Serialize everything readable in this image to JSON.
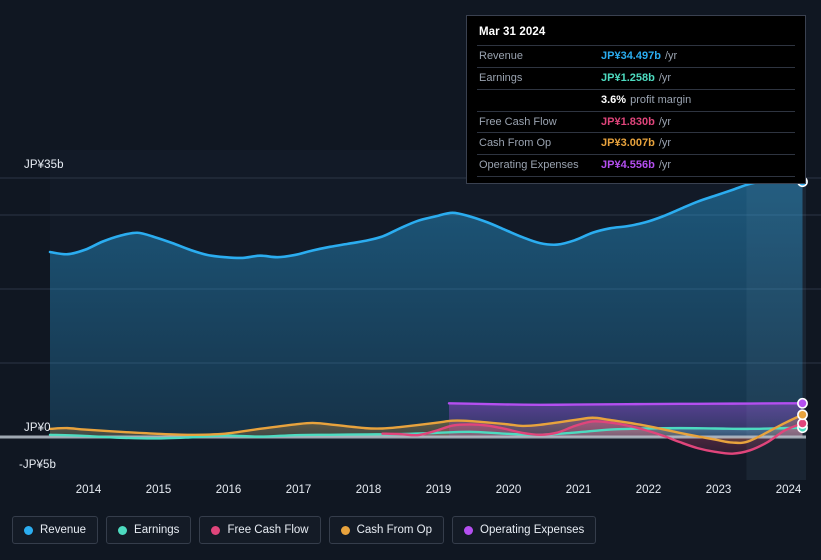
{
  "tooltip": {
    "date": "Mar 31 2024",
    "rows": [
      {
        "label": "Revenue",
        "value": "JP¥34.497b",
        "suffix": "/yr",
        "color": "#2badf0"
      },
      {
        "label": "Earnings",
        "value": "JP¥1.258b",
        "suffix": "/yr",
        "color": "#4ddbc0"
      },
      {
        "label": "",
        "value": "3.6%",
        "suffix": "profit margin",
        "color": "#ffffff"
      },
      {
        "label": "Free Cash Flow",
        "value": "JP¥1.830b",
        "suffix": "/yr",
        "color": "#e0457b"
      },
      {
        "label": "Cash From Op",
        "value": "JP¥3.007b",
        "suffix": "/yr",
        "color": "#e8a33d"
      },
      {
        "label": "Operating Expenses",
        "value": "JP¥4.556b",
        "suffix": "/yr",
        "color": "#b44ff0"
      }
    ]
  },
  "axis": {
    "y_top_label": "JP¥35b",
    "y_zero_label": "JP¥0",
    "y_bottom_label": "-JP¥5b"
  },
  "legend": {
    "items": [
      {
        "label": "Revenue",
        "color": "#2badf0"
      },
      {
        "label": "Earnings",
        "color": "#4ddbc0"
      },
      {
        "label": "Free Cash Flow",
        "color": "#e0457b"
      },
      {
        "label": "Cash From Op",
        "color": "#e8a33d"
      },
      {
        "label": "Operating Expenses",
        "color": "#b44ff0"
      }
    ]
  },
  "chart_data": {
    "type": "area",
    "title": "",
    "xlabel": "",
    "ylabel": "",
    "currency": "JP¥",
    "unit": "b",
    "grid": true,
    "legend_position": "bottom",
    "ylim": [
      -5,
      35
    ],
    "y_ticks": [
      -5,
      0,
      35
    ],
    "y_gridlines": [
      35,
      30,
      20,
      10,
      0
    ],
    "x_tick_labels": [
      "2014",
      "2015",
      "2016",
      "2017",
      "2018",
      "2019",
      "2020",
      "2021",
      "2022",
      "2023",
      "2024"
    ],
    "x_range": [
      2013.5,
      2024.3
    ],
    "series": [
      {
        "name": "Revenue",
        "color": "#2badf0",
        "filled": true,
        "x": [
          2013.5,
          2013.75,
          2014.0,
          2014.25,
          2014.5,
          2014.75,
          2015.0,
          2015.25,
          2015.5,
          2015.75,
          2016.0,
          2016.25,
          2016.5,
          2016.75,
          2017.0,
          2017.25,
          2017.5,
          2017.75,
          2018.0,
          2018.25,
          2018.5,
          2018.75,
          2019.0,
          2019.25,
          2019.5,
          2019.75,
          2020.0,
          2020.25,
          2020.5,
          2020.75,
          2021.0,
          2021.25,
          2021.5,
          2021.75,
          2022.0,
          2022.25,
          2022.5,
          2022.75,
          2023.0,
          2023.25,
          2023.5,
          2023.75,
          2024.0,
          2024.25
        ],
        "values": [
          25.0,
          24.7,
          25.3,
          26.4,
          27.2,
          27.6,
          27.0,
          26.2,
          25.3,
          24.6,
          24.3,
          24.2,
          24.5,
          24.3,
          24.6,
          25.2,
          25.7,
          26.1,
          26.5,
          27.1,
          28.2,
          29.2,
          29.8,
          30.3,
          29.8,
          29.0,
          28.0,
          27.0,
          26.2,
          26.0,
          26.6,
          27.6,
          28.2,
          28.5,
          29.0,
          29.8,
          30.8,
          31.8,
          32.6,
          33.4,
          34.2,
          34.6,
          34.7,
          34.497
        ]
      },
      {
        "name": "Earnings",
        "color": "#4ddbc0",
        "filled": true,
        "x": [
          2013.5,
          2014.0,
          2014.5,
          2015.0,
          2015.5,
          2016.0,
          2016.5,
          2017.0,
          2017.5,
          2018.0,
          2018.5,
          2019.0,
          2019.5,
          2020.0,
          2020.5,
          2021.0,
          2021.5,
          2022.0,
          2022.5,
          2023.0,
          2023.5,
          2024.0,
          2024.25
        ],
        "values": [
          0.3,
          0.15,
          -0.1,
          -0.2,
          -0.05,
          0.2,
          0.05,
          0.25,
          0.3,
          0.35,
          0.4,
          0.55,
          0.7,
          0.45,
          0.3,
          0.6,
          1.0,
          1.15,
          1.2,
          1.15,
          1.1,
          1.2,
          1.258
        ]
      },
      {
        "name": "Free Cash Flow",
        "color": "#e0457b",
        "filled": true,
        "x": [
          2018.25,
          2018.5,
          2018.75,
          2019.0,
          2019.25,
          2019.5,
          2019.75,
          2020.0,
          2020.25,
          2020.5,
          2020.75,
          2021.0,
          2021.25,
          2021.5,
          2021.75,
          2022.0,
          2022.25,
          2022.5,
          2022.75,
          2023.0,
          2023.25,
          2023.5,
          2023.75,
          2024.0,
          2024.25
        ],
        "values": [
          0.45,
          0.4,
          0.25,
          0.8,
          1.55,
          1.7,
          1.55,
          1.1,
          0.55,
          0.3,
          0.6,
          1.5,
          2.1,
          1.95,
          1.55,
          0.95,
          0.2,
          -0.7,
          -1.5,
          -2.0,
          -2.25,
          -1.8,
          -0.7,
          0.9,
          1.83
        ]
      },
      {
        "name": "Cash From Op",
        "color": "#e8a33d",
        "filled": true,
        "x": [
          2013.5,
          2013.75,
          2014.0,
          2014.5,
          2015.0,
          2015.5,
          2016.0,
          2016.5,
          2017.0,
          2017.25,
          2017.5,
          2018.0,
          2018.25,
          2018.5,
          2019.0,
          2019.25,
          2019.5,
          2020.0,
          2020.25,
          2020.5,
          2021.0,
          2021.25,
          2021.5,
          2022.0,
          2022.5,
          2023.0,
          2023.25,
          2023.5,
          2024.0,
          2024.25
        ],
        "values": [
          1.1,
          1.2,
          1.0,
          0.7,
          0.45,
          0.3,
          0.45,
          1.1,
          1.7,
          1.9,
          1.7,
          1.2,
          1.15,
          1.35,
          1.9,
          2.2,
          2.15,
          1.75,
          1.5,
          1.65,
          2.3,
          2.6,
          2.3,
          1.55,
          0.55,
          -0.35,
          -0.75,
          -0.5,
          1.9,
          3.007
        ]
      },
      {
        "name": "Operating Expenses",
        "color": "#b44ff0",
        "filled": true,
        "x": [
          2019.2,
          2019.5,
          2020.0,
          2020.5,
          2021.0,
          2021.5,
          2022.0,
          2022.5,
          2023.0,
          2023.5,
          2024.0,
          2024.25
        ],
        "values": [
          4.55,
          4.5,
          4.4,
          4.35,
          4.38,
          4.42,
          4.45,
          4.48,
          4.5,
          4.52,
          4.55,
          4.556
        ]
      }
    ]
  }
}
